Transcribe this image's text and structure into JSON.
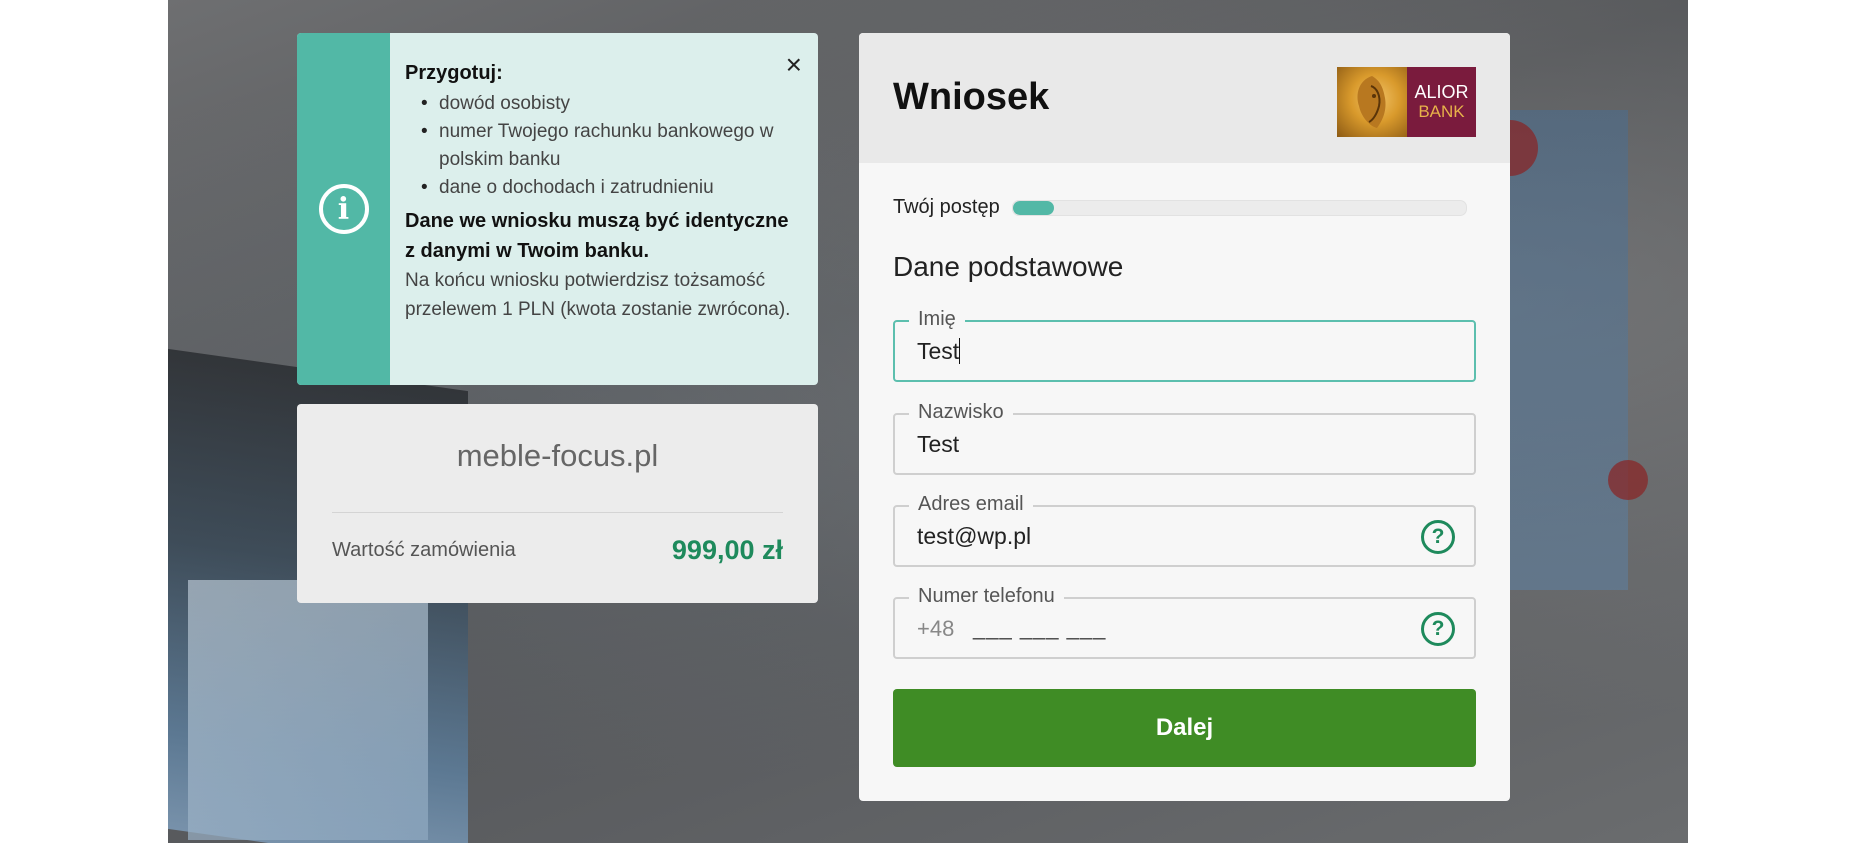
{
  "info_panel": {
    "title": "Przygotuj:",
    "items": [
      "dowód osobisty",
      "numer Twojego rachunku bankowego w polskim banku",
      "dane o dochodach i zatrudnieniu"
    ],
    "warning": "Dane we wniosku muszą być identyczne z danymi w Twoim banku.",
    "note": "Na końcu wniosku potwierdzisz tożsamość przelewem 1 PLN (kwota zostanie zwrócona).",
    "close_symbol": "×"
  },
  "shop": {
    "name": "meble-focus.pl",
    "order_label": "Wartość zamówienia",
    "order_value": "999,00 zł"
  },
  "form": {
    "title": "Wniosek",
    "logo": {
      "line1": "ALIOR",
      "line2": "BANK"
    },
    "progress_label": "Twój postęp",
    "progress_fraction": 0.09,
    "section_title": "Dane podstawowe",
    "fields": {
      "first_name": {
        "label": "Imię",
        "value": "Test"
      },
      "last_name": {
        "label": "Nazwisko",
        "value": "Test"
      },
      "email": {
        "label": "Adres email",
        "value": "test@wp.pl"
      },
      "phone": {
        "label": "Numer telefonu",
        "prefix": "+48",
        "mask": "___ ___ ___"
      }
    },
    "submit_label": "Dalej"
  },
  "icons": {
    "info": "info-icon",
    "help": "question-circle-icon",
    "close": "close-icon"
  },
  "colors": {
    "accent_teal": "#52b8a6",
    "info_bg": "#dcefec",
    "button_green": "#3f8c25",
    "price_green": "#1e8a5c"
  }
}
